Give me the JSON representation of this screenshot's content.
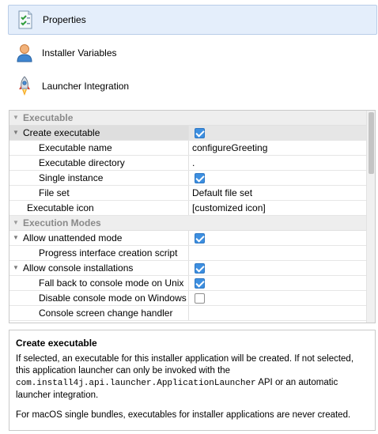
{
  "nav": {
    "items": [
      {
        "label": "Properties",
        "icon": "properties-checklist-icon",
        "selected": true
      },
      {
        "label": "Installer Variables",
        "icon": "user-icon",
        "selected": false
      },
      {
        "label": "Launcher Integration",
        "icon": "rocket-icon",
        "selected": false
      }
    ]
  },
  "grid": {
    "categories": {
      "executable": "Executable",
      "execution_modes": "Execution Modes"
    },
    "rows": {
      "create_executable": {
        "name": "Create executable",
        "checked": true
      },
      "executable_name": {
        "name": "Executable name",
        "value": "configureGreeting"
      },
      "executable_directory": {
        "name": "Executable directory",
        "value": "."
      },
      "single_instance": {
        "name": "Single instance",
        "checked": true
      },
      "file_set": {
        "name": "File set",
        "value": "Default file set"
      },
      "executable_icon": {
        "name": "Executable icon",
        "value": "[customized icon]"
      },
      "allow_unattended": {
        "name": "Allow unattended mode",
        "checked": true
      },
      "progress_script": {
        "name": "Progress interface creation script",
        "value": ""
      },
      "allow_console": {
        "name": "Allow console installations",
        "checked": true
      },
      "fallback_console": {
        "name": "Fall back to console mode on Unix",
        "checked": true
      },
      "disable_console_windows": {
        "name": "Disable console mode on Windows",
        "checked": false
      },
      "console_screen_handler": {
        "name": "Console screen change handler",
        "value": ""
      }
    }
  },
  "description": {
    "title": "Create executable",
    "line1": "If selected, an executable for this installer application will be created. If not selected, this application launcher can only be invoked with the",
    "code": "com.install4j.api.launcher.ApplicationLauncher",
    "line2": " API or an automatic launcher integration.",
    "note": "For macOS single bundles, executables for installer applications are never created."
  },
  "colors": {
    "accent": "#3d8fe0",
    "selection": "#e4eefb"
  }
}
